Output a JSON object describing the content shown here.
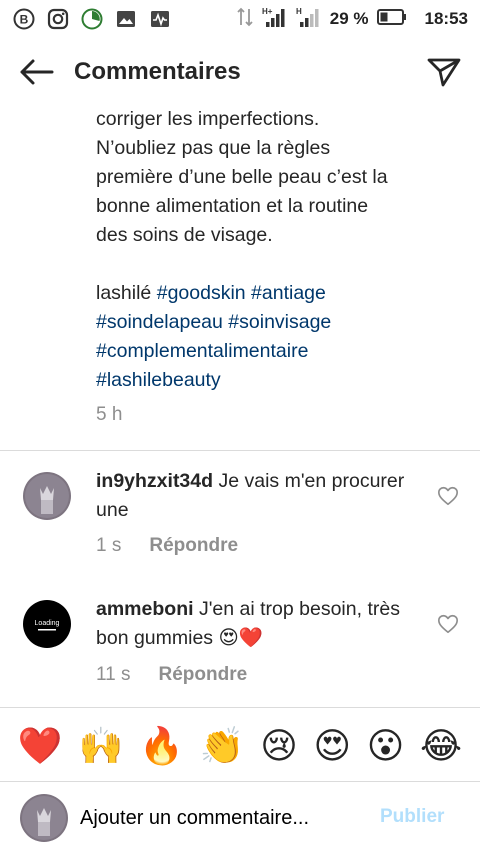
{
  "status_bar": {
    "battery_percent": "29 %",
    "time": "18:53",
    "network_1": "H+",
    "network_2": "H"
  },
  "header": {
    "title": "Commentaires"
  },
  "caption": {
    "lines": [
      "corriger les imperfections.",
      "N’oubliez pas que la règles",
      "première d’une belle peau c’est la",
      "bonne alimentation et la routine",
      "des soins de visage."
    ],
    "author_tag": "lashilé",
    "hashtags_line1": [
      "#goodskin",
      "#antiage"
    ],
    "hashtags_line2": [
      "#soindelapeau",
      "#soinvisage"
    ],
    "hashtags_line3": [
      "#complementalimentaire"
    ],
    "hashtags_line4": [
      "#lashilebeauty"
    ],
    "time": "5 h"
  },
  "comments": [
    {
      "username": "in9yhzxit34d",
      "text": "Je vais m'en procurer une",
      "time": "1 s",
      "reply_label": "Répondre"
    },
    {
      "username": "ammeboni",
      "text": "J'en ai trop besoin, très bon gummies 😍❤️",
      "time": "11 s",
      "reply_label": "Répondre",
      "avatar_text": "Loading"
    }
  ],
  "emoji_bar": [
    "❤️",
    "🙌",
    "🔥",
    "👏",
    "😢",
    "😍",
    "😮",
    "😂"
  ],
  "composer": {
    "placeholder": "Ajouter un commentaire...",
    "post_label": "Publier"
  },
  "colors": {
    "hashtag": "#00376b",
    "muted": "#8e8e8e",
    "post_disabled": "#b2dffc",
    "divider": "#dbdbdb"
  }
}
